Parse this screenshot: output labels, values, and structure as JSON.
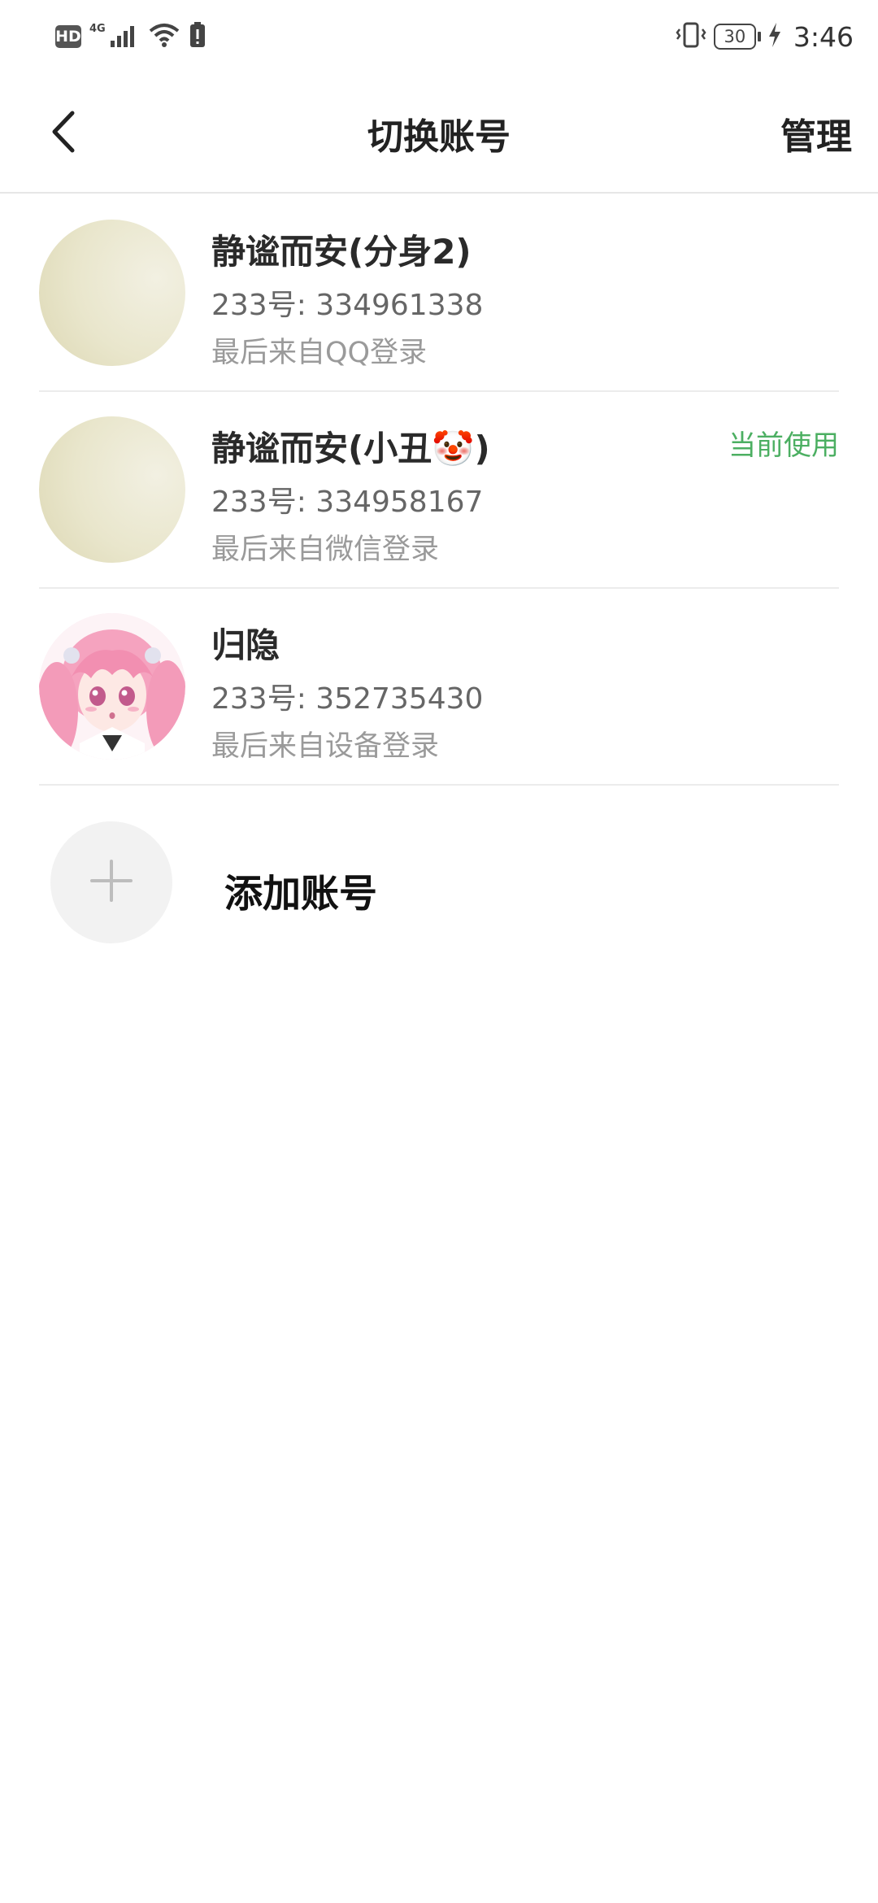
{
  "status_bar": {
    "hd_label": "HD",
    "network_label": "4G",
    "battery_level": "30",
    "time": "3:46",
    "icons": [
      "signal-icon",
      "wifi-icon",
      "alert-icon",
      "vibrate-icon",
      "charging-icon"
    ]
  },
  "header": {
    "title": "切换账号",
    "manage_label": "管理"
  },
  "accounts": [
    {
      "name": "静谧而安(分身2)",
      "id_text": "233号: 334961338",
      "login_text": "最后来自QQ登录",
      "badge": ""
    },
    {
      "name": "静谧而安(小丑🤡)",
      "id_text": "233号: 334958167",
      "login_text": "最后来自微信登录",
      "badge": "当前使用"
    },
    {
      "name": "归隐",
      "id_text": "233号: 352735430",
      "login_text": "最后来自设备登录",
      "badge": ""
    }
  ],
  "add_account": {
    "label": "添加账号"
  },
  "colors": {
    "accent_green": "#4caf62",
    "divider": "#ececec"
  }
}
